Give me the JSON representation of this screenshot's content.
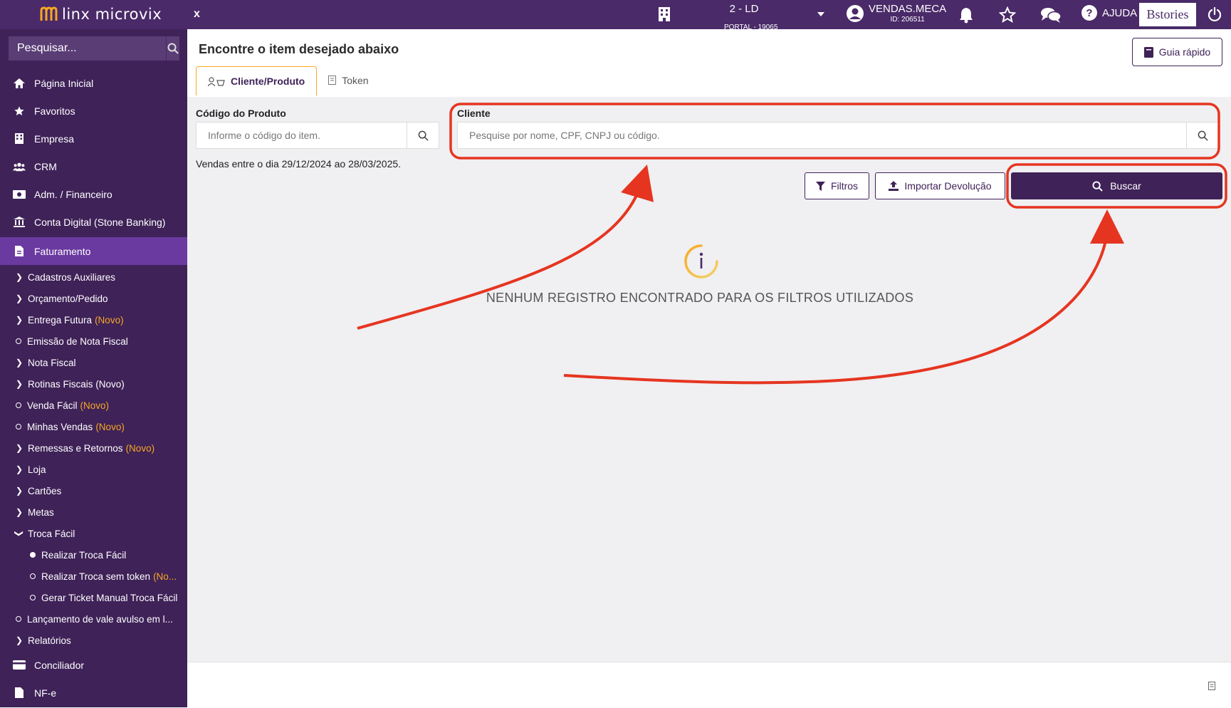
{
  "topbar": {
    "logo_text": "linx microvix",
    "close_label": "x",
    "store_name": "2 - LD",
    "store_sub": "PORTAL - 19065",
    "user_name": "VENDAS.MECA",
    "user_id": "ID: 206511",
    "help_label": "AJUDA",
    "brand_label": "Bstories",
    "icons": [
      "building-icon",
      "bell-icon",
      "star-icon",
      "chat-icon",
      "help-icon",
      "power-icon"
    ]
  },
  "sidebar": {
    "search_placeholder": "Pesquisar...",
    "items": [
      {
        "label": "Página Inicial",
        "icon": "home-icon"
      },
      {
        "label": "Favoritos",
        "icon": "star-icon"
      },
      {
        "label": "Empresa",
        "icon": "building-icon"
      },
      {
        "label": "CRM",
        "icon": "users-icon"
      },
      {
        "label": "Adm. / Financeiro",
        "icon": "money-icon"
      },
      {
        "label": "Conta Digital (Stone Banking)",
        "icon": "bank-icon"
      },
      {
        "label": "Faturamento",
        "icon": "invoice-icon"
      }
    ],
    "sub_items": [
      {
        "label": "Cadastros Auxiliares",
        "novo": ""
      },
      {
        "label": "Orçamento/Pedido",
        "novo": ""
      },
      {
        "label": "Entrega Futura",
        "novo": "(Novo)"
      },
      {
        "label": "Emissão de Nota Fiscal",
        "novo": ""
      },
      {
        "label": "Nota Fiscal",
        "novo": ""
      },
      {
        "label": "Rotinas Fiscais (Novo)",
        "novo": ""
      },
      {
        "label": "Venda Fácil",
        "novo": "(Novo)"
      },
      {
        "label": "Minhas Vendas",
        "novo": "(Novo)"
      },
      {
        "label": "Remessas e Retornos",
        "novo": "(Novo)"
      },
      {
        "label": "Loja",
        "novo": ""
      },
      {
        "label": "Cartões",
        "novo": ""
      },
      {
        "label": "Metas",
        "novo": ""
      },
      {
        "label": "Troca Fácil",
        "novo": ""
      },
      {
        "label": "Realizar Troca Fácil",
        "novo": ""
      },
      {
        "label": "Realizar Troca sem token",
        "novo": "(No..."
      },
      {
        "label": "Gerar Ticket Manual Troca Fácil",
        "novo": ""
      },
      {
        "label": "Lançamento de vale avulso em l...",
        "novo": ""
      },
      {
        "label": "Relatórios",
        "novo": ""
      }
    ],
    "bottom_items": [
      {
        "label": "Conciliador",
        "icon": "card-icon"
      },
      {
        "label": "NF-e",
        "icon": "file-icon"
      }
    ]
  },
  "main": {
    "title": "Encontre o item desejado abaixo",
    "guide_button": "Guia rápido",
    "tabs": [
      {
        "label": "Cliente/Produto",
        "icon": "client-product-icon"
      },
      {
        "label": "Token",
        "icon": "receipt-icon"
      }
    ],
    "product_code_label": "Código do Produto",
    "product_code_placeholder": "Informe o código do item.",
    "client_label": "Cliente",
    "client_placeholder": "Pesquise por nome, CPF, CNPJ ou código.",
    "sales_note": "Vendas entre o dia 29/12/2024 ao 28/03/2025.",
    "filters_button": "Filtros",
    "import_button": "Importar Devolução",
    "search_button": "Buscar",
    "empty_message": "NENHUM REGISTRO ENCONTRADO PARA OS FILTROS UTILIZADOS"
  },
  "colors": {
    "brand_purple": "#4a2a68",
    "sidebar_bg": "#3f2258",
    "active_item": "#6a3aa0",
    "accent_orange": "#f7a823",
    "annotation_red": "#e53520"
  }
}
